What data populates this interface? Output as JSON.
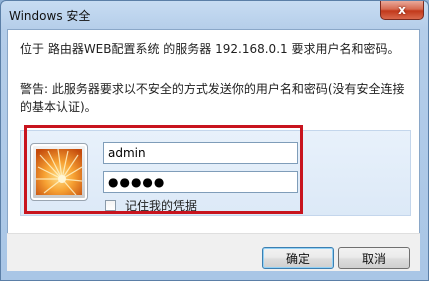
{
  "window": {
    "title": "Windows 安全",
    "close_label": "x"
  },
  "message": {
    "line1": "位于 路由器WEB配置系统 的服务器 192.168.0.1 要求用户名和密码。",
    "warning": "警告: 此服务器要求以不安全的方式发送你的用户名和密码(没有安全连接的基本认证)。"
  },
  "credentials": {
    "username_value": "admin",
    "password_value": "●●●●●",
    "remember_label": "记住我的凭据",
    "remember_checked": false,
    "avatar_icon": "user-flower-icon"
  },
  "buttons": {
    "ok_label": "确定",
    "cancel_label": "取消"
  },
  "colors": {
    "highlight": "#c8141e",
    "title_bar": "#b4cde9",
    "close_button": "#c2391b"
  }
}
